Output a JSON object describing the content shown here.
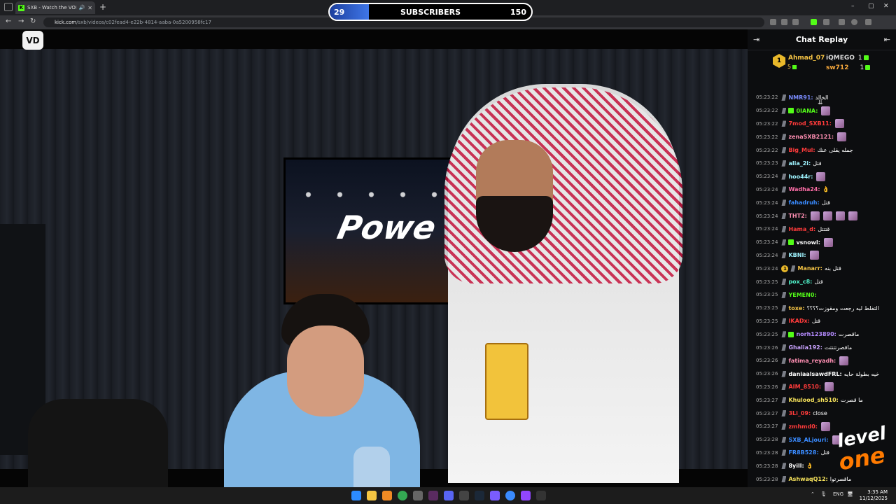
{
  "browser": {
    "tab_title": "SXB - Watch the VOD on K",
    "tab_favicon": "K",
    "new_tab": "+",
    "url_host": "kick.com",
    "url_path": "/sxb/videos/c02fead4-e22b-4814-aaba-0a5200958fc17",
    "minimize": "–",
    "maximize": "▢",
    "close": "✕"
  },
  "overlay": {
    "sub_current": "29",
    "sub_label": "SUBSCRIBERS",
    "sub_goal": "150",
    "sub_progress": 0.193,
    "vod_button": "VD",
    "tv_logo": "Powe"
  },
  "chat": {
    "title": "Chat Replay",
    "leaderboard": {
      "first": {
        "rank": "1",
        "name": "Ahmad_07",
        "count": "5"
      },
      "second": {
        "name": "iQMEGO",
        "count": "1"
      },
      "third": {
        "name": "sw712",
        "count": "1"
      }
    },
    "messages": [
      {
        "time": "05:23:22",
        "user": "NMR91",
        "color": "#7b8cff",
        "text": "الخالد",
        "emotes": 0
      },
      {
        "time": "05:23:22",
        "user": "0IANA",
        "color": "#53fc18",
        "text": "",
        "emotes": 1,
        "sub": true
      },
      {
        "time": "05:23:22",
        "user": "7mod_SXB11",
        "color": "#ff3b3b",
        "text": "",
        "emotes": 1
      },
      {
        "time": "05:23:22",
        "user": "zenaSXB2121",
        "color": "#ff8fb3",
        "text": "",
        "emotes": 1
      },
      {
        "time": "05:23:22",
        "user": "Big_Mul",
        "color": "#ff3b3b",
        "text": "جمله يقلى عنك",
        "emotes": 0
      },
      {
        "time": "05:23:23",
        "user": "alia_2i",
        "color": "#9ff4ff",
        "text": "قتل",
        "emotes": 0
      },
      {
        "time": "05:23:24",
        "user": "hoo44r",
        "color": "#9ff4ff",
        "text": "",
        "emotes": 1
      },
      {
        "time": "05:23:24",
        "user": "Wadha24",
        "color": "#ff6ea8",
        "text": "👌",
        "emotes": 0
      },
      {
        "time": "05:23:24",
        "user": "fahadruh",
        "color": "#3a8bff",
        "text": "قتل",
        "emotes": 0
      },
      {
        "time": "05:23:24",
        "user": "THT2",
        "color": "#ff8fb3",
        "text": "",
        "emotes": 4
      },
      {
        "time": "05:23:24",
        "user": "Hama_d",
        "color": "#ff3b3b",
        "text": "قتتتل",
        "emotes": 0
      },
      {
        "time": "05:23:24",
        "user": "vsnowl",
        "color": "#ffffff",
        "text": "",
        "emotes": 1,
        "sub": true
      },
      {
        "time": "05:23:24",
        "user": "KBNI",
        "color": "#9ff4ff",
        "text": "",
        "emotes": 1
      },
      {
        "time": "05:23:24",
        "user": "Manarr",
        "color": "#f6c445",
        "text": "قتل بنه",
        "emotes": 0,
        "gold": "1"
      },
      {
        "time": "05:23:25",
        "user": "pox_c8",
        "color": "#4ff0c8",
        "text": "قتل",
        "emotes": 0
      },
      {
        "time": "05:23:25",
        "user": "YEMEN0",
        "color": "#53fc18",
        "text": "",
        "emotes": 0
      },
      {
        "time": "05:23:25",
        "user": "toxe",
        "color": "#f6c445",
        "text": "التفلط ليه رجعت ومقوزت؟؟؟؟",
        "emotes": 0
      },
      {
        "time": "05:23:25",
        "user": "IKADx",
        "color": "#ff3b3b",
        "text": "قتل",
        "emotes": 0
      },
      {
        "time": "05:23:25",
        "user": "norh123890",
        "color": "#b58bff",
        "text": "ماقصرت",
        "emotes": 0,
        "sub": true
      },
      {
        "time": "05:23:26",
        "user": "Ghalia192",
        "color": "#c9a3ff",
        "text": "ماقصرتتتتت",
        "emotes": 0
      },
      {
        "time": "05:23:26",
        "user": "fatima_reyadh",
        "color": "#ff8fb3",
        "text": "",
        "emotes": 1
      },
      {
        "time": "05:23:26",
        "user": "daniaalsawdFRL",
        "color": "#ffffff",
        "text": "خيه بطولة حايه",
        "emotes": 0
      },
      {
        "time": "05:23:26",
        "user": "AIM_8510",
        "color": "#ff3b3b",
        "text": "",
        "emotes": 1
      },
      {
        "time": "05:23:27",
        "user": "Khulood_sh510",
        "color": "#f6e25b",
        "text": "ما قصرت",
        "emotes": 0
      },
      {
        "time": "05:23:27",
        "user": "3Li_09",
        "color": "#ff3b3b",
        "text": "close",
        "emotes": 0
      },
      {
        "time": "05:23:27",
        "user": "zmhmd0",
        "color": "#ff3b3b",
        "text": "",
        "emotes": 1
      },
      {
        "time": "05:23:28",
        "user": "SXB_ALjouri",
        "color": "#3a8bff",
        "text": "",
        "emotes": 1
      },
      {
        "time": "05:23:28",
        "user": "FR8B528",
        "color": "#3a8bff",
        "text": "قتل",
        "emotes": 0
      },
      {
        "time": "05:23:28",
        "user": "8yill",
        "color": "#ffffff",
        "text": "👌",
        "emotes": 0
      },
      {
        "time": "05:23:28",
        "user": "AshwaqQ12",
        "color": "#f6e25b",
        "text": "ماقصرتوا",
        "emotes": 0
      }
    ]
  },
  "sponsor": {
    "line1": "level",
    "line2": "one"
  },
  "taskbar": {
    "lang": "ENG",
    "time": "3:35 AM",
    "date": "11/12/2025"
  }
}
